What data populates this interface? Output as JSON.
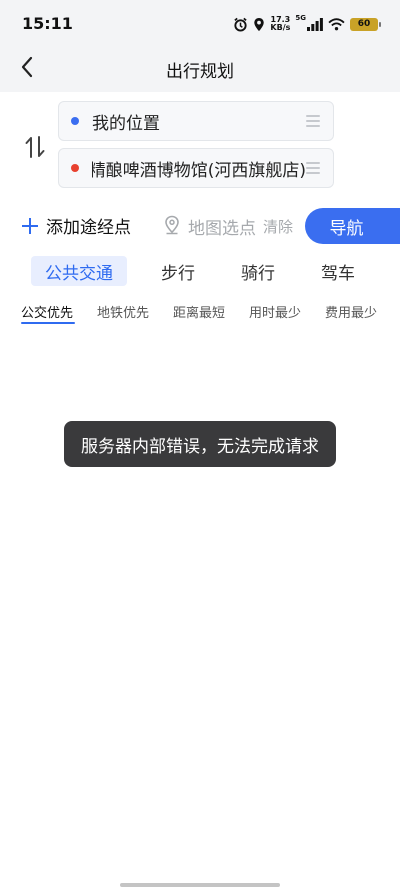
{
  "status_bar": {
    "time": "15:11",
    "net_speed_value": "17.3",
    "net_speed_unit": "KB/s",
    "signal_label": "5G",
    "battery": "60",
    "icons": [
      "alarm-icon",
      "location-icon",
      "signal-icon",
      "wifi-icon",
      "battery-icon"
    ]
  },
  "header": {
    "title": "出行规划",
    "back_icon": "chevron-left-icon"
  },
  "route": {
    "from": "我的位置",
    "to": "精酿啤酒博物馆(河西旗舰店)",
    "from_dot_color": "#3b6ef0",
    "to_dot_color": "#e8412f",
    "swap_icon": "swap-vertical-icon"
  },
  "actions": {
    "add_waypoint": "添加途经点",
    "map_pick": "地图选点",
    "clear": "清除",
    "navigate": "导航"
  },
  "mode_tabs": [
    {
      "label": "公共交通",
      "active": true
    },
    {
      "label": "步行",
      "active": false
    },
    {
      "label": "骑行",
      "active": false
    },
    {
      "label": "驾车",
      "active": false
    }
  ],
  "sub_tabs": [
    {
      "label": "公交优先",
      "active": true
    },
    {
      "label": "地铁优先",
      "active": false
    },
    {
      "label": "距离最短",
      "active": false
    },
    {
      "label": "用时最少",
      "active": false
    },
    {
      "label": "费用最少",
      "active": false
    }
  ],
  "toast": {
    "message": "服务器内部错误，无法完成请求"
  },
  "colors": {
    "accent": "#2f6bf0",
    "nav_button": "#3a6ef0",
    "toast_bg": "#3a3a3c"
  }
}
